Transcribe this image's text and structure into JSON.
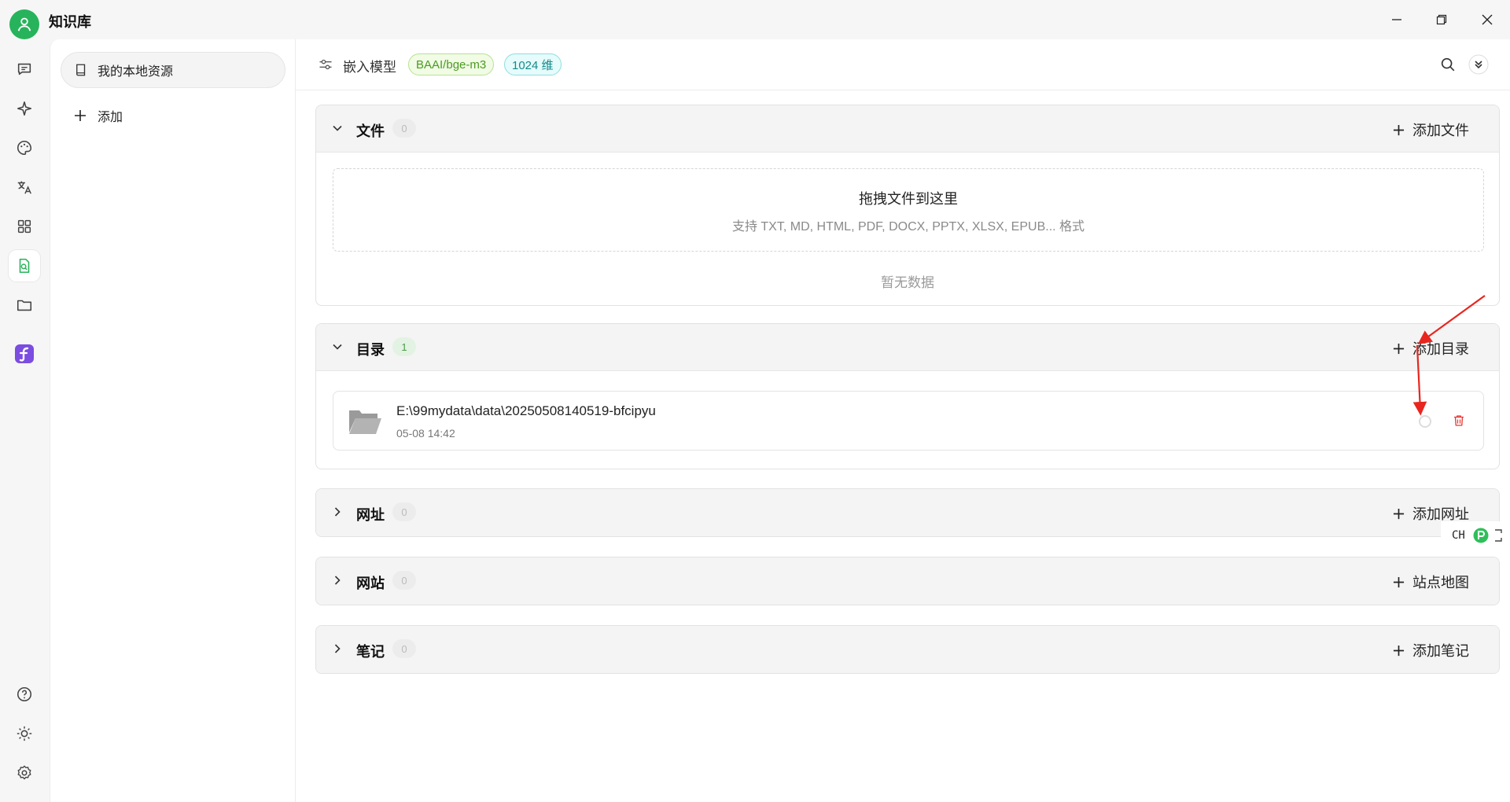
{
  "app": {
    "title": "知识库",
    "accent": "#27b35b"
  },
  "window_controls": [
    "minimize-icon",
    "restore-icon",
    "close-icon"
  ],
  "rail": {
    "top_icons": [
      "chat-icon",
      "sparkle-icon",
      "palette-icon",
      "translate-icon",
      "apps-grid-icon",
      "knowledge-icon",
      "folder-icon",
      "app-logo-icon"
    ],
    "bottom_icons": [
      "help-icon",
      "brightness-icon",
      "settings-icon"
    ],
    "active": "knowledge-icon"
  },
  "resources": {
    "items": [
      {
        "label": "我的本地资源"
      }
    ],
    "add_label": "添加"
  },
  "toolbar": {
    "label": "嵌入模型",
    "model_tag": "BAAI/bge-m3",
    "dim_tag": "1024 维"
  },
  "sections": {
    "files": {
      "title": "文件",
      "count": "0",
      "action": "添加文件",
      "drop_title": "拖拽文件到这里",
      "drop_formats": "支持 TXT, MD, HTML, PDF, DOCX, PPTX, XLSX, EPUB... 格式",
      "empty": "暂无数据"
    },
    "directories": {
      "title": "目录",
      "count": "1",
      "action": "添加目录",
      "items": [
        {
          "path": "E:\\99mydata\\data\\20250508140519-bfcipyu",
          "time": "05-08 14:42"
        }
      ]
    },
    "urls": {
      "title": "网址",
      "count": "0",
      "action": "添加网址"
    },
    "sites": {
      "title": "网站",
      "count": "0",
      "action": "站点地图"
    },
    "notes": {
      "title": "笔记",
      "count": "0",
      "action": "添加笔记"
    }
  },
  "ime": {
    "label": "CH"
  }
}
